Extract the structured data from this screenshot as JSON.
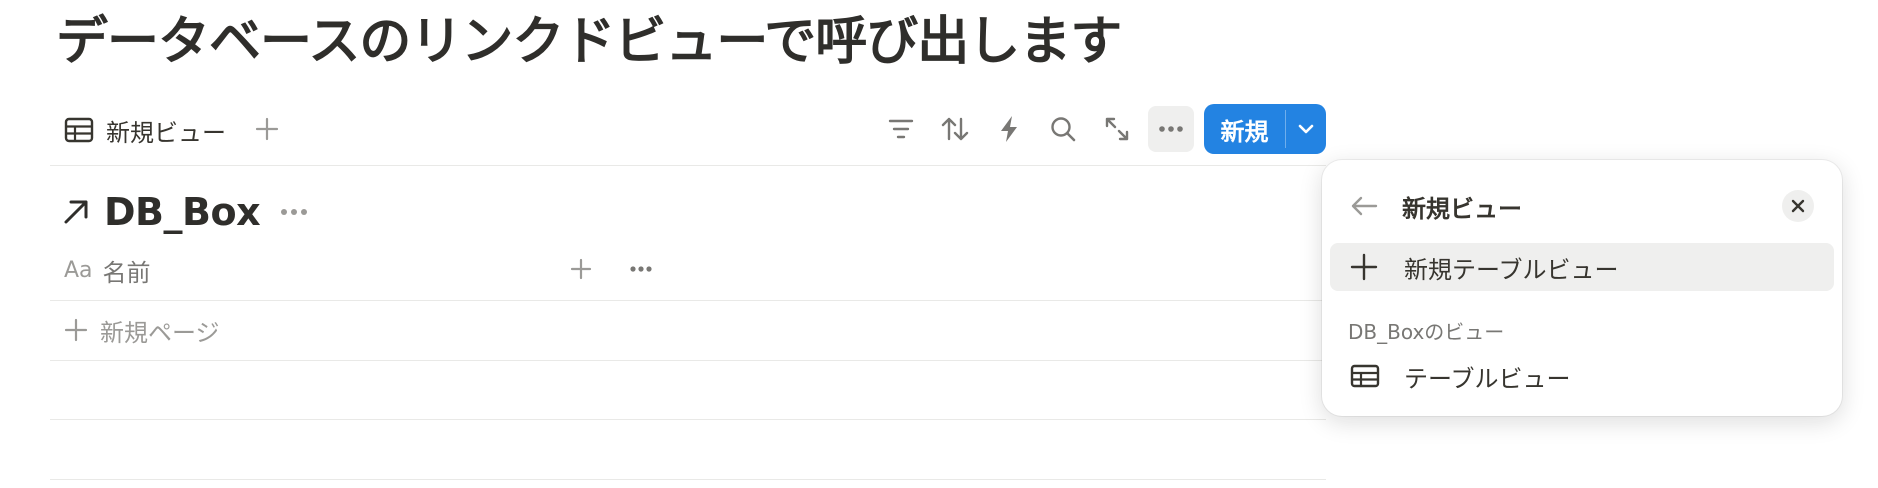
{
  "page": {
    "title": "データベースのリンクドビューで呼び出します"
  },
  "view_tabs": {
    "active_label": "新規ビュー",
    "add_icon": "plus-icon"
  },
  "toolbar": {
    "icons": [
      "filter-icon",
      "sort-icon",
      "lightning-icon",
      "search-icon",
      "expand-icon",
      "more-icon"
    ],
    "new_label": "新規"
  },
  "database": {
    "name": "DB_Box",
    "link_icon": "arrow-up-right-icon",
    "column": {
      "type_label": "Aa",
      "name": "名前"
    },
    "new_page_label": "新規ページ"
  },
  "view_menu": {
    "title": "新規ビュー",
    "new_table_view_label": "新規テーブルビュー",
    "section_label": "DB_Boxのビュー",
    "views": [
      {
        "label": "テーブルビュー",
        "icon": "table-icon"
      }
    ]
  },
  "colors": {
    "accent": "#2383e2",
    "text": "#37352f",
    "muted": "#787774",
    "hover": "#efefee"
  }
}
